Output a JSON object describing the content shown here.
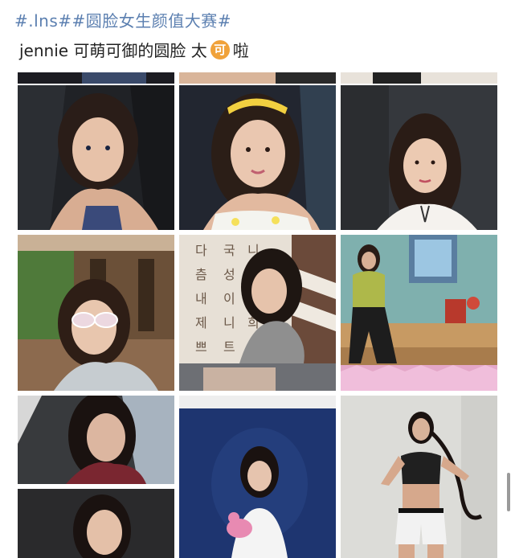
{
  "post": {
    "hashtag": "#.lns##圆脸女生颜值大赛#",
    "caption_before": "jennie 可萌可御的圆脸 太",
    "caption_badge": "可",
    "caption_after": "啦"
  },
  "colors": {
    "hashtag": "#5b7fb0",
    "badge": "#f0a23a"
  },
  "photos": [
    {
      "id": "photo-1",
      "desc_icon": "selfie-dark-background"
    },
    {
      "id": "photo-2",
      "desc_icon": "selfie-yellow-headband"
    },
    {
      "id": "photo-3",
      "desc_icon": "portrait-white-top"
    },
    {
      "id": "photo-4",
      "desc_icon": "sunglasses-cafe"
    },
    {
      "id": "photo-5",
      "desc_icon": "gray-hoodie-korean-wall"
    },
    {
      "id": "photo-6",
      "desc_icon": "toy-room-sitting"
    },
    {
      "id": "photo-7",
      "desc_icon": "dark-portrait-stack"
    },
    {
      "id": "photo-8",
      "desc_icon": "blue-backdrop-pink-toy"
    },
    {
      "id": "photo-9",
      "desc_icon": "sport-braids"
    }
  ]
}
